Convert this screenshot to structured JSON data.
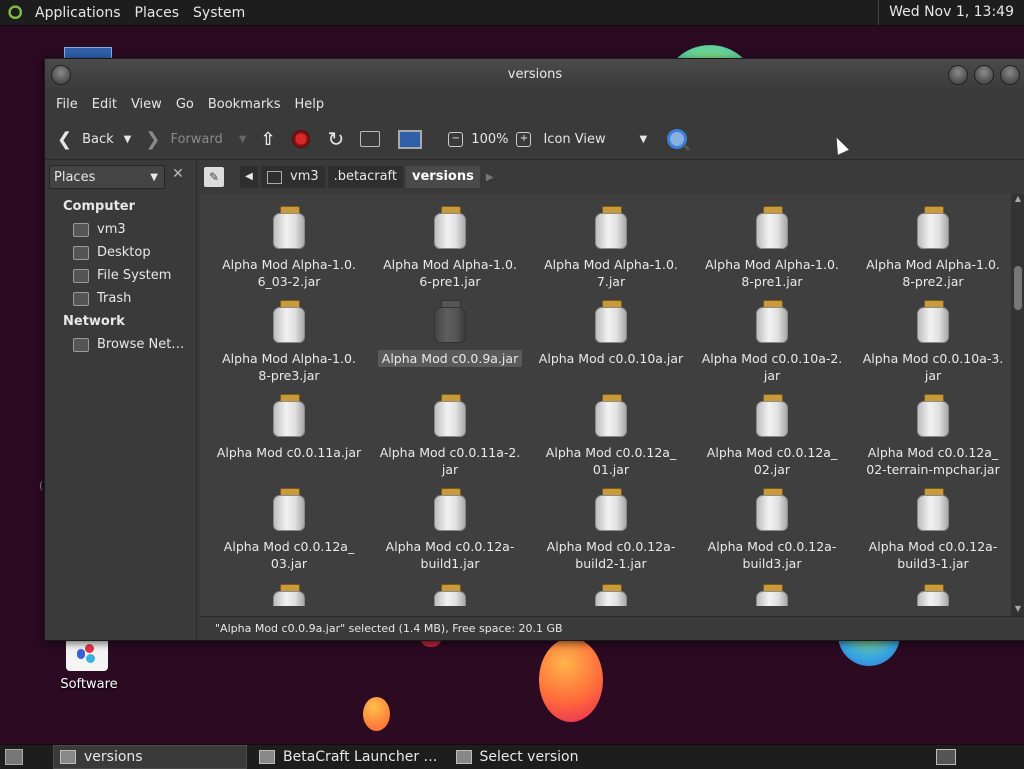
{
  "top_panel": {
    "menus": [
      "Applications",
      "Places",
      "System"
    ],
    "clock": "Wed Nov 1, 13:49"
  },
  "desktop": {
    "software_label": "Software"
  },
  "window": {
    "title": "versions",
    "menubar": [
      "File",
      "Edit",
      "View",
      "Go",
      "Bookmarks",
      "Help"
    ],
    "toolbar": {
      "back_label": "Back",
      "forward_label": "Forward",
      "zoom_level": "100%",
      "view_mode": "Icon View"
    },
    "sidebar": {
      "selector_label": "Places",
      "sections": [
        {
          "heading": "Computer",
          "items": [
            "vm3",
            "Desktop",
            "File System",
            "Trash"
          ]
        },
        {
          "heading": "Network",
          "items": [
            "Browse Net…"
          ]
        }
      ]
    },
    "breadcrumbs": [
      "vm3",
      ".betacraft",
      "versions"
    ],
    "files": [
      {
        "name": "Alpha Mod Alpha-1.0.6_03-2.jar",
        "line1": "Alpha Mod Alpha-1.0.",
        "line2": "6_03-2.jar"
      },
      {
        "name": "Alpha Mod Alpha-1.0.6-pre1.jar",
        "line1": "Alpha Mod Alpha-1.0.",
        "line2": "6-pre1.jar"
      },
      {
        "name": "Alpha Mod Alpha-1.0.7.jar",
        "line1": "Alpha Mod Alpha-1.0.",
        "line2": "7.jar"
      },
      {
        "name": "Alpha Mod Alpha-1.0.8-pre1.jar",
        "line1": "Alpha Mod Alpha-1.0.",
        "line2": "8-pre1.jar"
      },
      {
        "name": "Alpha Mod Alpha-1.0.8-pre2.jar",
        "line1": "Alpha Mod Alpha-1.0.",
        "line2": "8-pre2.jar"
      },
      {
        "name": "Alpha Mod Alpha-1.0.8-pre3.jar",
        "line1": "Alpha Mod Alpha-1.0.",
        "line2": "8-pre3.jar"
      },
      {
        "name": "Alpha Mod c0.0.9a.jar",
        "line1": "Alpha Mod c0.0.9a.jar",
        "line2": "",
        "selected": true
      },
      {
        "name": "Alpha Mod c0.0.10a.jar",
        "line1": "Alpha Mod c0.0.10a.jar",
        "line2": ""
      },
      {
        "name": "Alpha Mod c0.0.10a-2.jar",
        "line1": "Alpha Mod c0.0.10a-2.",
        "line2": "jar"
      },
      {
        "name": "Alpha Mod c0.0.10a-3.jar",
        "line1": "Alpha Mod c0.0.10a-3.",
        "line2": "jar"
      },
      {
        "name": "Alpha Mod c0.0.11a.jar",
        "line1": "Alpha Mod c0.0.11a.jar",
        "line2": ""
      },
      {
        "name": "Alpha Mod c0.0.11a-2.jar",
        "line1": "Alpha Mod c0.0.11a-2.",
        "line2": "jar"
      },
      {
        "name": "Alpha Mod c0.0.12a_01.jar",
        "line1": "Alpha Mod c0.0.12a_",
        "line2": "01.jar"
      },
      {
        "name": "Alpha Mod c0.0.12a_02.jar",
        "line1": "Alpha Mod c0.0.12a_",
        "line2": "02.jar"
      },
      {
        "name": "Alpha Mod c0.0.12a_02-terrain-mpchar.jar",
        "line1": "Alpha Mod c0.0.12a_",
        "line2": "02-terrain-mpchar.jar"
      },
      {
        "name": "Alpha Mod c0.0.12a_03.jar",
        "line1": "Alpha Mod c0.0.12a_",
        "line2": "03.jar"
      },
      {
        "name": "Alpha Mod c0.0.12a-build1.jar",
        "line1": "Alpha Mod c0.0.12a-",
        "line2": "build1.jar"
      },
      {
        "name": "Alpha Mod c0.0.12a-build2-1.jar",
        "line1": "Alpha Mod c0.0.12a-",
        "line2": "build2-1.jar"
      },
      {
        "name": "Alpha Mod c0.0.12a-build3.jar",
        "line1": "Alpha Mod c0.0.12a-",
        "line2": "build3.jar"
      },
      {
        "name": "Alpha Mod c0.0.12a-build3-1.jar",
        "line1": "Alpha Mod c0.0.12a-",
        "line2": "build3-1.jar"
      }
    ],
    "status": "\"Alpha Mod c0.0.9a.jar\" selected (1.4 MB), Free space: 20.1 GB"
  },
  "taskbar": {
    "tasks": [
      "versions",
      "BetaCraft Launcher …",
      "Select version"
    ]
  }
}
